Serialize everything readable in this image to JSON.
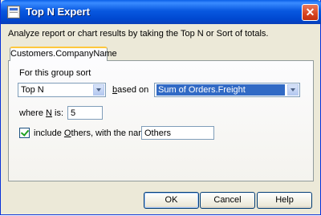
{
  "window": {
    "title": "Top N Expert",
    "close_glyph": "✕"
  },
  "description": "Analyze report or chart results by taking the Top N or Sort of totals.",
  "tab": {
    "label": "Customers.CompanyName"
  },
  "panel": {
    "group_sort_label": "For this group sort",
    "sort_type": {
      "value": "Top N"
    },
    "based_on_label_pre": "",
    "based_on_label_u": "b",
    "based_on_label_post": "ased on",
    "based_on": {
      "value": "Sum of Orders.Freight"
    },
    "where_label_pre": "where ",
    "where_label_u": "N",
    "where_label_post": " is:",
    "n_value": "5",
    "include_others": {
      "checked": true,
      "label_pre": "include ",
      "label_u": "O",
      "label_post": "thers, with the name:"
    },
    "others_name": "Others"
  },
  "buttons": {
    "ok": "OK",
    "cancel": "Cancel",
    "help": "Help"
  },
  "colors": {
    "titlebar": "#0858e0",
    "selection": "#316ac5",
    "dialog_bg": "#ece9d8"
  }
}
